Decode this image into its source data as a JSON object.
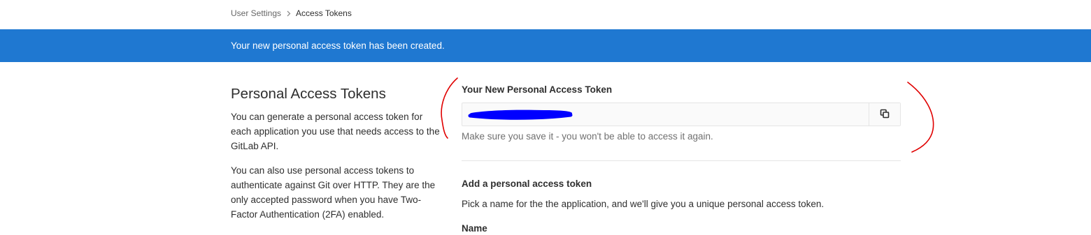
{
  "breadcrumb": {
    "parent": "User Settings",
    "current": "Access Tokens"
  },
  "flash": {
    "message": "Your new personal access token has been created."
  },
  "sidebar": {
    "title": "Personal Access Tokens",
    "description_1": "You can generate a personal access token for each application you use that needs access to the GitLab API.",
    "description_2": "You can also use personal access tokens to authenticate against Git over HTTP. They are the only accepted password when you have Two-Factor Authentication (2FA) enabled."
  },
  "new_token": {
    "label": "Your New Personal Access Token",
    "value": "",
    "copy_icon": "copy-icon",
    "hint": "Make sure you save it - you won't be able to access it again."
  },
  "add_token": {
    "title": "Add a personal access token",
    "description": "Pick a name for the the application, and we'll give you a unique personal access token.",
    "name_label": "Name"
  },
  "colors": {
    "flash_bg": "#1f78d1",
    "redaction": "#0000ff",
    "annotation": "#e00000"
  }
}
